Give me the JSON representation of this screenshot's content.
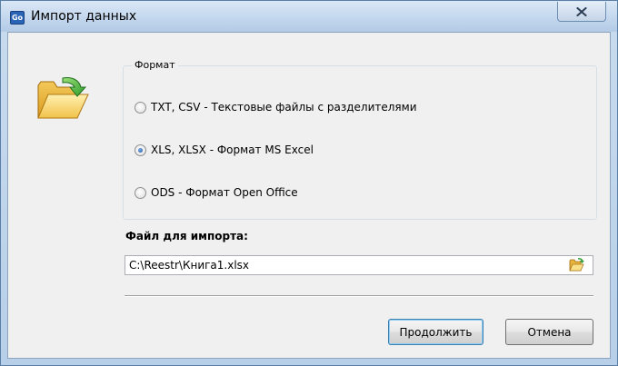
{
  "window": {
    "title": "Импорт данных",
    "app_icon_text": "Go"
  },
  "format_group": {
    "title": "Формат",
    "options": [
      {
        "label": "TXT, CSV - Текстовые файлы с разделителями",
        "checked": false
      },
      {
        "label": "XLS, XLSX - Формат MS Excel",
        "checked": true
      },
      {
        "label": "ODS - Формат Open Office",
        "checked": false
      }
    ]
  },
  "file": {
    "label": "Файл для импорта:",
    "value": "C:\\Reestr\\Книга1.xlsx"
  },
  "buttons": {
    "continue_label": "Продолжить",
    "cancel_label": "Отмена"
  },
  "colors": {
    "titlebar": "#c3d7ee",
    "client_bg": "#f0f0f0",
    "primary_border": "#3c7fb1"
  }
}
